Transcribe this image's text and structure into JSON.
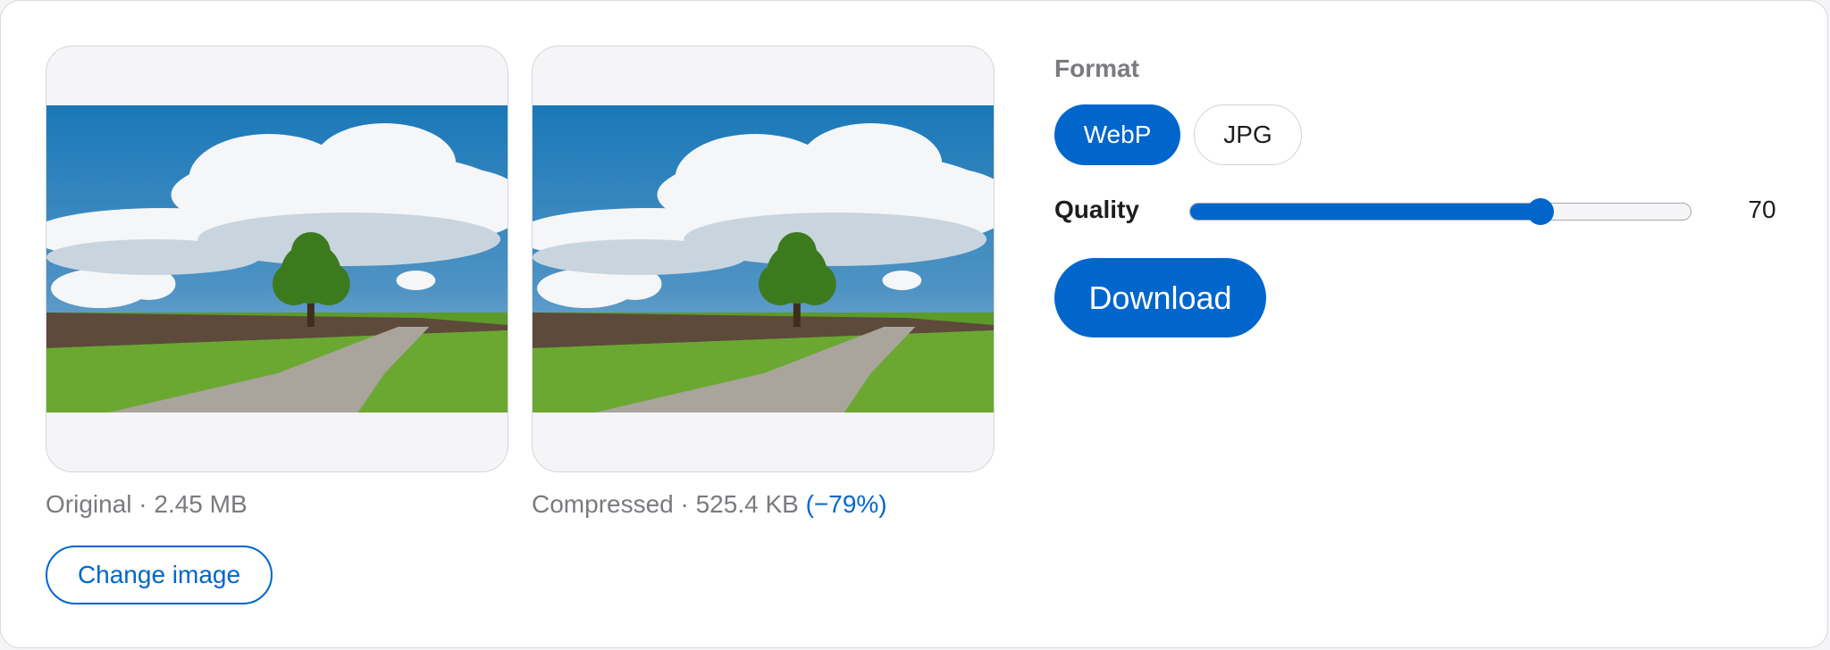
{
  "previews": {
    "original": {
      "label": "Original · 2.45 MB"
    },
    "compressed": {
      "label": "Compressed · 525.4 KB",
      "savings": "(−79%)"
    }
  },
  "change_image_label": "Change image",
  "format": {
    "label": "Format",
    "options": [
      "WebP",
      "JPG"
    ],
    "selected": "WebP"
  },
  "quality": {
    "label": "Quality",
    "value": 70,
    "min": 0,
    "max": 100,
    "display": "70"
  },
  "download_label": "Download",
  "colors": {
    "accent": "#0066cc",
    "muted_text": "#7a7a7f",
    "panel_bg": "#f5f5f7"
  },
  "icons": {
    "preview_image": "landscape-photo"
  }
}
